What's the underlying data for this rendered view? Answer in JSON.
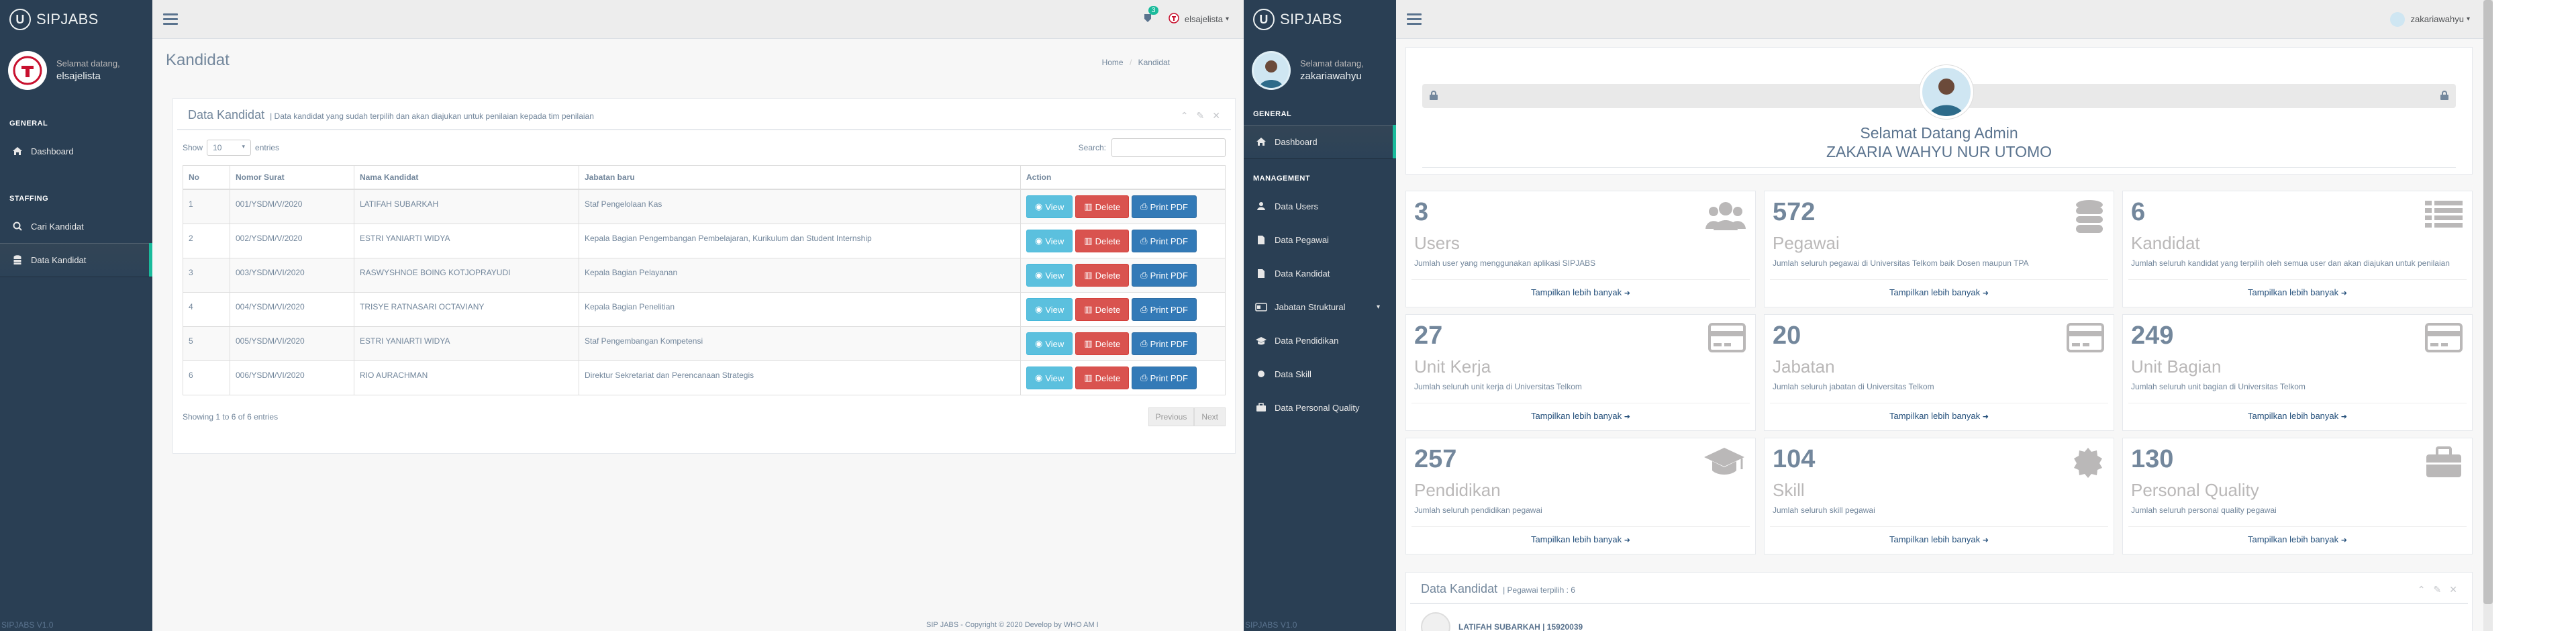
{
  "left_app": {
    "brand": "SIPJABS",
    "welcome": "Selamat datang,",
    "user": "elsajelista",
    "sections": [
      "GENERAL",
      "STAFFING"
    ],
    "nav": [
      {
        "label": "Dashboard",
        "icon": "home-icon"
      },
      {
        "label": "Cari Kandidat",
        "icon": "search-icon"
      },
      {
        "label": "Data Kandidat",
        "icon": "database-icon"
      }
    ],
    "footer": "SIPJABS V1.0",
    "topbar": {
      "notif_count": "3",
      "user": "elsajelista"
    },
    "page_title": "Kandidat",
    "breadcrumb": [
      "Home",
      "Kandidat"
    ],
    "panel": {
      "title": "Data Kandidat",
      "subtitle": "| Data kandidat yang sudah terpilih dan akan diajukan untuk penilaian kepada tim penilaian",
      "show_label": "Show",
      "show_value": "10",
      "entries_label": "entries",
      "search_label": "Search:",
      "columns": [
        "No",
        "Nomor Surat",
        "Nama Kandidat",
        "Jabatan baru",
        "Action"
      ],
      "rows": [
        [
          "1",
          "001/YSDM/V/2020",
          "LATIFAH SUBARKAH",
          "Staf Pengelolaan Kas"
        ],
        [
          "2",
          "002/YSDM/V/2020",
          "ESTRI YANIARTI WIDYA",
          "Kepala Bagian Pengembangan Pembelajaran, Kurikulum dan Student Internship"
        ],
        [
          "3",
          "003/YSDM/VI/2020",
          "RASWYSHNOE BOING KOTJOPRAYUDI",
          "Kepala Bagian Pelayanan"
        ],
        [
          "4",
          "004/YSDM/VI/2020",
          "TRISYE RATNASARI OCTAVIANY",
          "Kepala Bagian Penelitian"
        ],
        [
          "5",
          "005/YSDM/VI/2020",
          "ESTRI YANIARTI WIDYA",
          "Staf Pengembangan Kompetensi"
        ],
        [
          "6",
          "006/YSDM/VI/2020",
          "RIO AURACHMAN",
          "Direktur Sekretariat dan Perencanaan Strategis"
        ]
      ],
      "btn_view": "View",
      "btn_delete": "Delete",
      "btn_pdf": "Print PDF",
      "info": "Showing 1 to 6 of 6 entries",
      "prev": "Previous",
      "next": "Next"
    },
    "page_footer": "SIP JABS - Copyright © 2020 Develop by WHO AM I"
  },
  "right_app": {
    "brand": "SIPJABS",
    "welcome": "Selamat datang,",
    "user": "zakariawahyu",
    "sections": [
      "GENERAL",
      "MANAGEMENT"
    ],
    "nav": [
      {
        "label": "Dashboard",
        "icon": "home-icon"
      },
      {
        "label": "Data Users",
        "icon": "users-icon"
      },
      {
        "label": "Data Pegawai",
        "icon": "file-icon"
      },
      {
        "label": "Data Kandidat",
        "icon": "file-icon"
      },
      {
        "label": "Jabatan Struktural",
        "icon": "id-card-icon"
      },
      {
        "label": "Data Pendidikan",
        "icon": "graduation-cap-icon"
      },
      {
        "label": "Data Skill",
        "icon": "circle-icon"
      },
      {
        "label": "Data Personal Quality",
        "icon": "briefcase-icon"
      }
    ],
    "footer": "SIPJABS V1.0",
    "topbar_user": "zakariawahyu",
    "welcome_banner": {
      "line1": "Selamat Datang Admin",
      "line2": "ZAKARIA WAHYU NUR UTOMO"
    },
    "tiles": [
      {
        "count": "3",
        "label": "Users",
        "desc": "Jumlah user yang menggunakan aplikasi SIPJABS",
        "icon": "users-icon"
      },
      {
        "count": "572",
        "label": "Pegawai",
        "desc": "Jumlah seluruh pegawai di Universitas Telkom baik Dosen maupun TPA",
        "icon": "database-icon"
      },
      {
        "count": "6",
        "label": "Kandidat",
        "desc": "Jumlah seluruh kandidat yang terpilih oleh semua user dan akan diajukan untuk penilaian",
        "icon": "list-icon"
      },
      {
        "count": "27",
        "label": "Unit Kerja",
        "desc": "Jumlah seluruh unit kerja di Universitas Telkom",
        "icon": "credit-card-icon"
      },
      {
        "count": "20",
        "label": "Jabatan",
        "desc": "Jumlah seluruh jabatan di Universitas Telkom",
        "icon": "credit-card-icon"
      },
      {
        "count": "249",
        "label": "Unit Bagian",
        "desc": "Jumlah seluruh unit bagian di Universitas Telkom",
        "icon": "credit-card-icon"
      },
      {
        "count": "257",
        "label": "Pendidikan",
        "desc": "Jumlah seluruh pendidikan pegawai",
        "icon": "graduation-cap-icon"
      },
      {
        "count": "104",
        "label": "Skill",
        "desc": "Jumlah seluruh skill pegawai",
        "icon": "certificate-icon"
      },
      {
        "count": "130",
        "label": "Personal Quality",
        "desc": "Jumlah seluruh personal quality pegawai",
        "icon": "briefcase-icon"
      }
    ],
    "more_label": "Tampilkan lebih banyak",
    "bottom_panel": {
      "title": "Data Kandidat",
      "subtitle": "| Pegawai terpilih : 6",
      "item": "LATIFAH SUBARKAH | 15920039"
    }
  }
}
